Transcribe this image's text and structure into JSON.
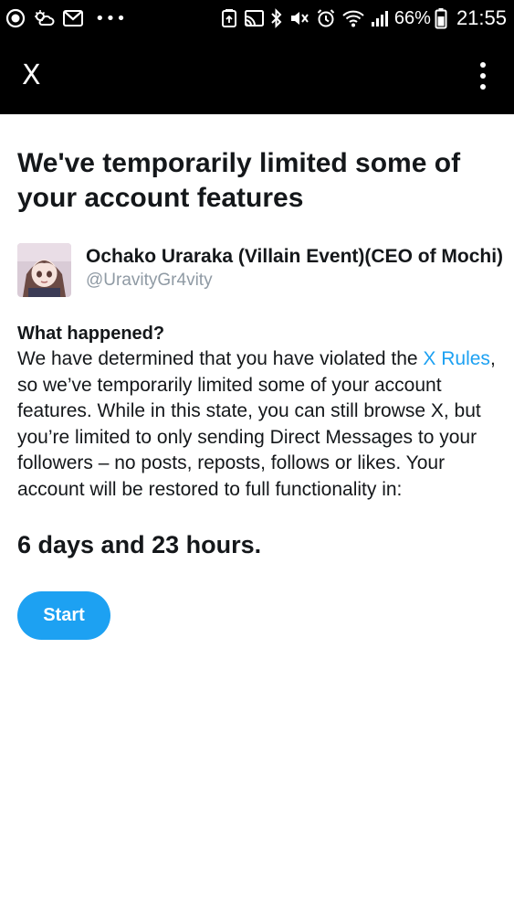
{
  "status_bar": {
    "left_icons": [
      "circle-check-icon",
      "weather-icon",
      "gmail-icon",
      "more-dots-icon"
    ],
    "more_dots": "•••",
    "right_icons": [
      "storage-icon",
      "cast-icon",
      "bluetooth-icon",
      "mute-icon",
      "alarm-icon",
      "wifi-icon",
      "signal-icon",
      "battery-icon"
    ],
    "battery_percent": "66%",
    "time": "21:55",
    "color": "#ffffff",
    "background": "#000000"
  },
  "app_bar": {
    "logo": "X",
    "menu_icon": "overflow-menu-icon"
  },
  "notice": {
    "headline": "We've temporarily limited some of your account features",
    "account": {
      "display_name": "Ochako Uraraka (Villain Event)(CEO of Mochi)",
      "handle": "@UravityGr4vity",
      "avatar": "avatar-image"
    },
    "what_happened_label": "What happened?",
    "body_before_link": "We have determined that you have violated the ",
    "link_text": "X Rules",
    "body_after_link": ", so we’ve temporarily limited some of your account features. While in this state, you can still browse X, but you’re limited to only sending Direct Messages to your followers – no posts, reposts, follows or likes. Your account will be restored to full functionality in:",
    "countdown": "6 days and 23 hours.",
    "start_button": "Start"
  },
  "colors": {
    "accent": "#1da1f2",
    "text": "#14171a",
    "secondary_text": "#8f9aa4",
    "bar_background": "#000000"
  }
}
